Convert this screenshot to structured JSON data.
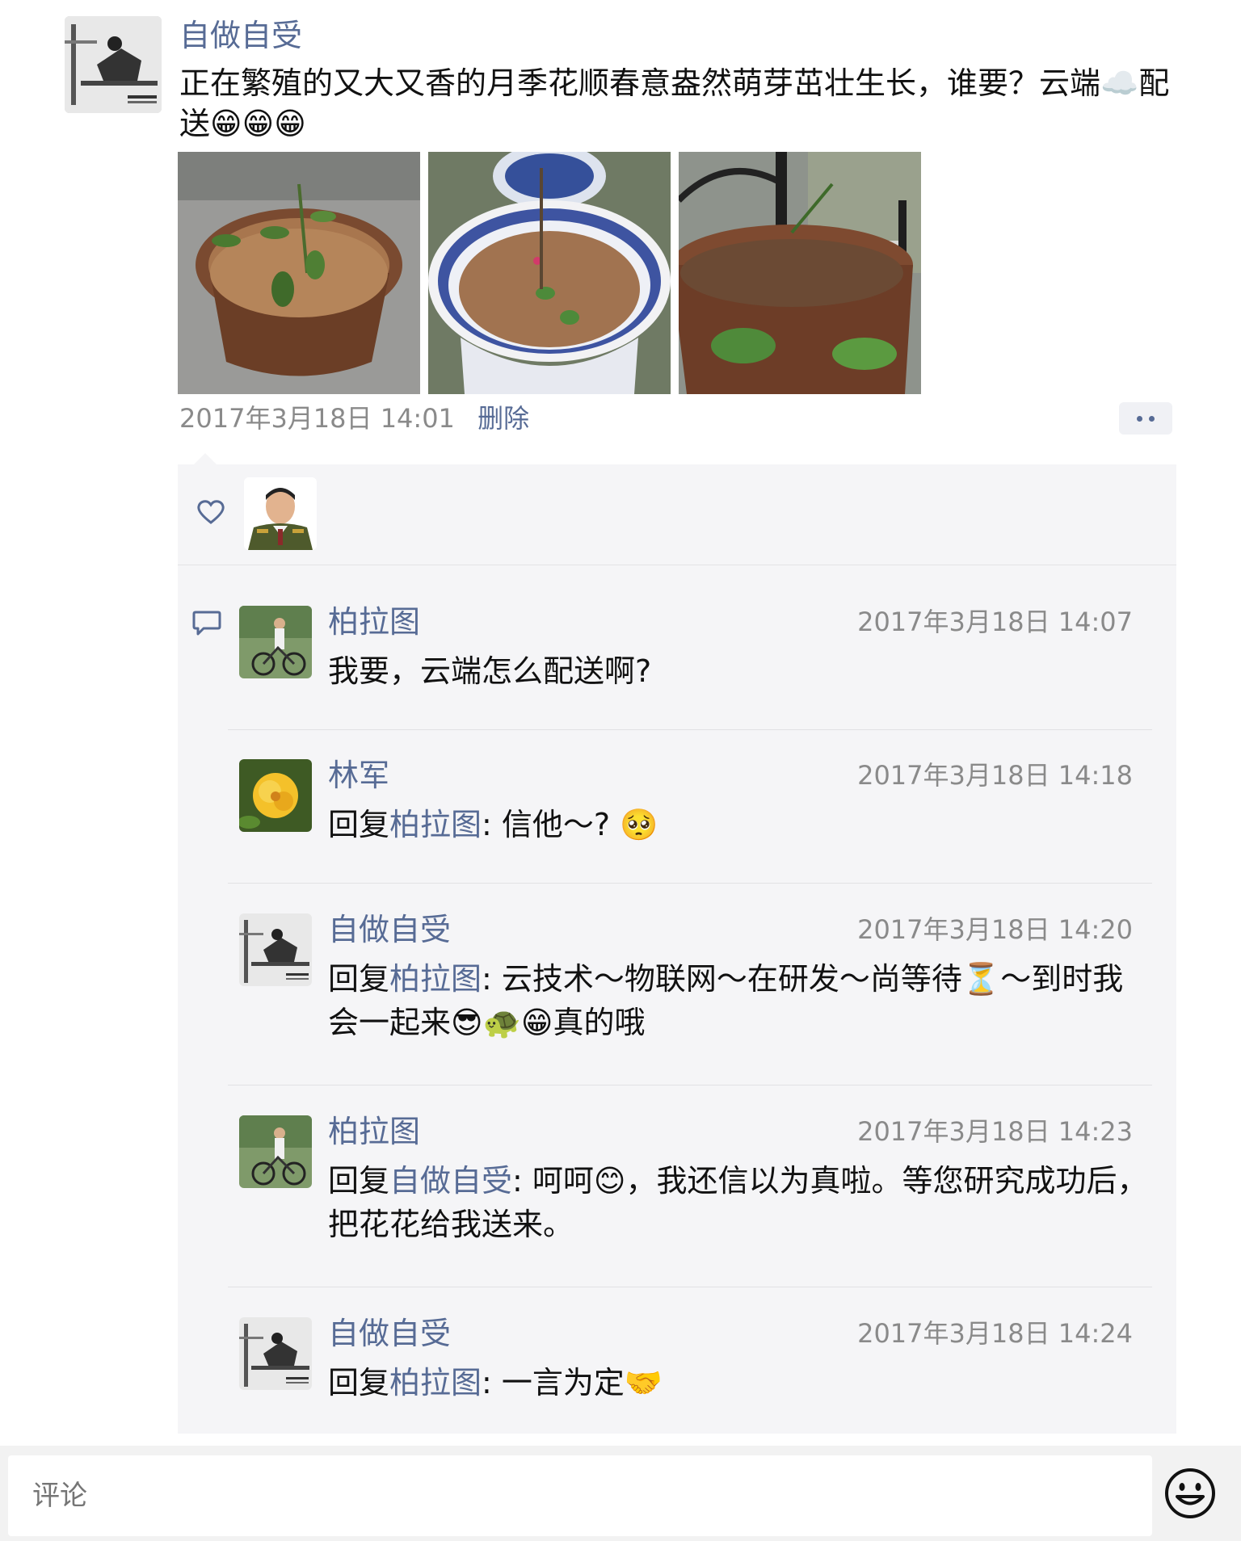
{
  "post": {
    "author": "自做自受",
    "text": "正在繁殖的又大又香的月季花顺春意盎然萌芽茁壮生长，谁要？云端☁️配送😁😁😁",
    "timestamp": "2017年3月18日 14:01",
    "delete_label": "删除",
    "photos": [
      "rose-pot-1",
      "rose-pot-2",
      "rose-pot-3"
    ]
  },
  "likes": {
    "icon": "heart-icon"
  },
  "comments": [
    {
      "name": "柏拉图",
      "time": "2017年3月18日 14:07",
      "reply_prefix": "",
      "reply_to": "",
      "text": "我要，云端怎么配送啊?"
    },
    {
      "name": "林军",
      "time": "2017年3月18日 14:18",
      "reply_prefix": "回复",
      "reply_to": "柏拉图",
      "text": ": 信他～? 🥺"
    },
    {
      "name": "自做自受",
      "time": "2017年3月18日 14:20",
      "reply_prefix": "回复",
      "reply_to": "柏拉图",
      "text": ": 云技术～物联网～在研发～尚等待⏳～到时我会一起来😎🐢😁真的哦"
    },
    {
      "name": "柏拉图",
      "time": "2017年3月18日 14:23",
      "reply_prefix": "回复",
      "reply_to": "自做自受",
      "text": ": 呵呵😊，我还信以为真啦。等您研究成功后，把花花给我送来。"
    },
    {
      "name": "自做自受",
      "time": "2017年3月18日 14:24",
      "reply_prefix": "回复",
      "reply_to": "柏拉图",
      "text": ": 一言为定🤝"
    }
  ],
  "input": {
    "placeholder": "评论"
  },
  "colors": {
    "link": "#576b95",
    "panel": "#f5f5f7",
    "meta": "#8a8a8a"
  }
}
